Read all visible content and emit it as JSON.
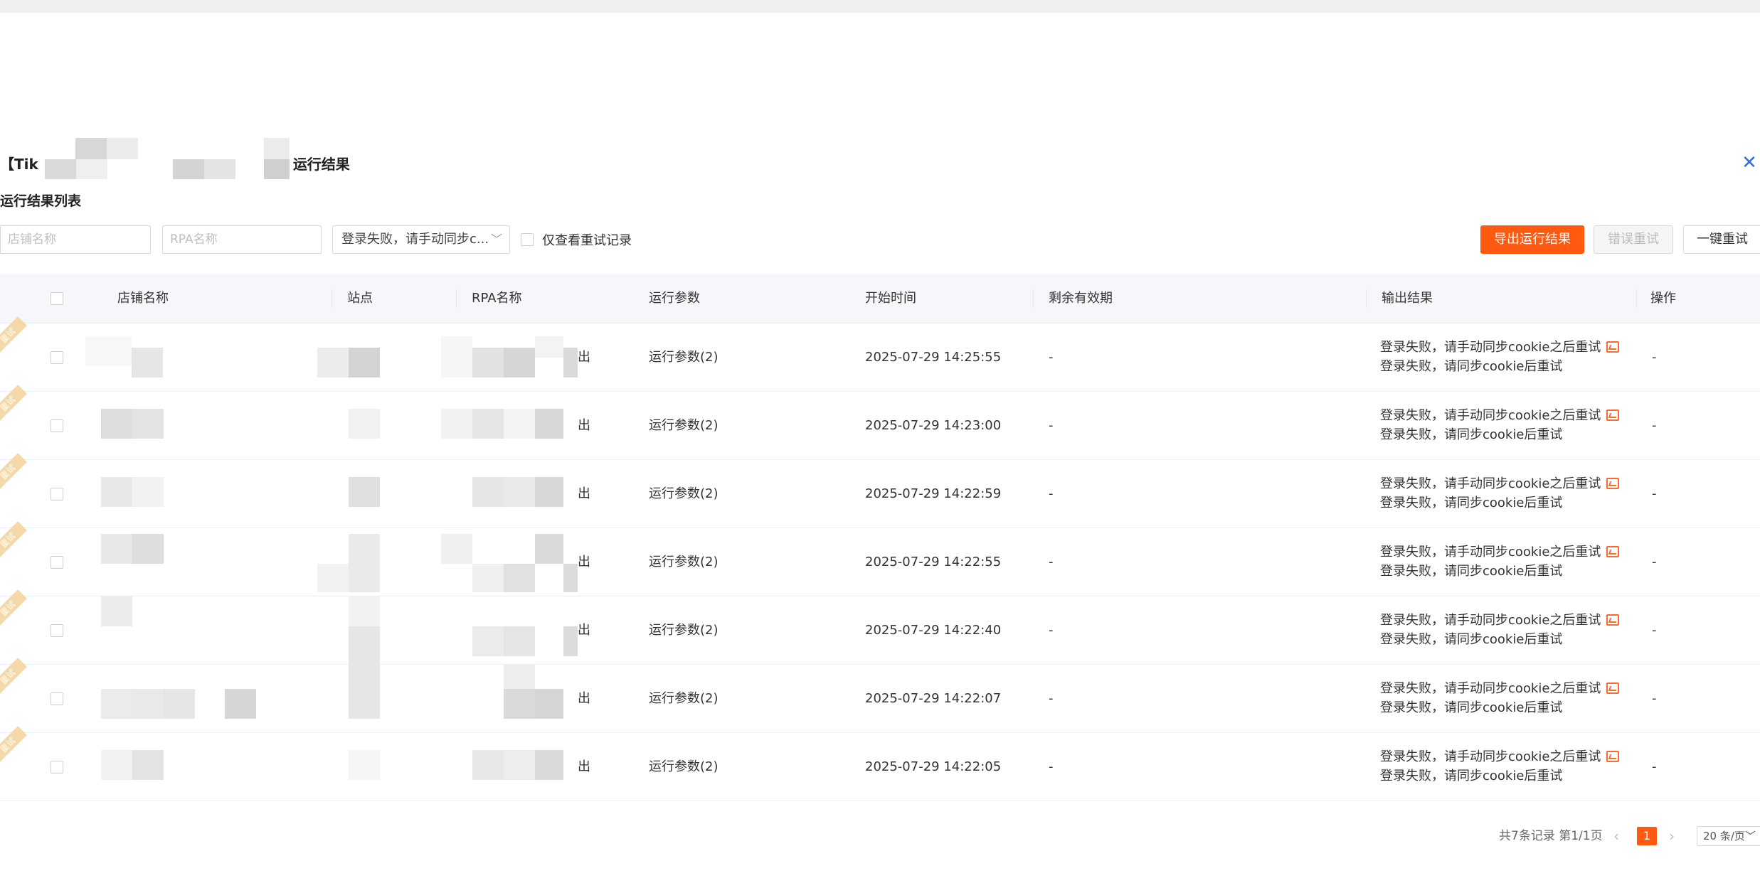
{
  "dialog": {
    "title_prefix": "【Tik",
    "title_suffix": "运行结果",
    "close_glyph": "✕",
    "section_title": "运行结果列表"
  },
  "filters": {
    "shop_placeholder": "店铺名称",
    "rpa_placeholder": "RPA名称",
    "status_value": "登录失败，请手动同步c...",
    "status_arrow": "﹀",
    "retry_only_label": "仅查看重试记录"
  },
  "actions": {
    "export_label": "导出运行结果",
    "error_retry_label": "错误重试",
    "retry_all_label": "一键重试"
  },
  "table": {
    "columns": [
      "店铺名称",
      "站点",
      "RPA名称",
      "运行参数",
      "开始时间",
      "剩余有效期",
      "输出结果",
      "操作"
    ],
    "ribbon_text": "重试",
    "rows": [
      {
        "rpa_suffix": "出",
        "params": "运行参数(2)",
        "start_time": "2025-07-29 14:25:55",
        "remaining": "-",
        "output_line1": "登录失败，请手动同步cookie之后重试",
        "output_line2": "登录失败，请同步cookie后重试",
        "action": "-"
      },
      {
        "rpa_suffix": "出",
        "params": "运行参数(2)",
        "start_time": "2025-07-29 14:23:00",
        "remaining": "-",
        "output_line1": "登录失败，请手动同步cookie之后重试",
        "output_line2": "登录失败，请同步cookie后重试",
        "action": "-"
      },
      {
        "rpa_suffix": "出",
        "params": "运行参数(2)",
        "start_time": "2025-07-29 14:22:59",
        "remaining": "-",
        "output_line1": "登录失败，请手动同步cookie之后重试",
        "output_line2": "登录失败，请同步cookie后重试",
        "action": "-"
      },
      {
        "rpa_suffix": "出",
        "params": "运行参数(2)",
        "start_time": "2025-07-29 14:22:55",
        "remaining": "-",
        "output_line1": "登录失败，请手动同步cookie之后重试",
        "output_line2": "登录失败，请同步cookie后重试",
        "action": "-"
      },
      {
        "rpa_suffix": "出",
        "params": "运行参数(2)",
        "start_time": "2025-07-29 14:22:40",
        "remaining": "-",
        "output_line1": "登录失败，请手动同步cookie之后重试",
        "output_line2": "登录失败，请同步cookie后重试",
        "action": "-"
      },
      {
        "rpa_suffix": "出",
        "params": "运行参数(2)",
        "start_time": "2025-07-29 14:22:07",
        "remaining": "-",
        "output_line1": "登录失败，请手动同步cookie之后重试",
        "output_line2": "登录失败，请同步cookie后重试",
        "action": "-"
      },
      {
        "rpa_suffix": "出",
        "params": "运行参数(2)",
        "start_time": "2025-07-29 14:22:05",
        "remaining": "-",
        "output_line1": "登录失败，请手动同步cookie之后重试",
        "output_line2": "登录失败，请同步cookie后重试",
        "action": "-"
      }
    ]
  },
  "pagination": {
    "summary": "共7条记录 第1/1页",
    "prev": "‹",
    "current": "1",
    "next": "›",
    "page_size": "20 条/页﹀"
  },
  "colors": {
    "accent": "#ff5a10",
    "close": "#3b6fd8",
    "ribbon": "#f4d9a8",
    "header_bg": "#f5f7fa"
  }
}
